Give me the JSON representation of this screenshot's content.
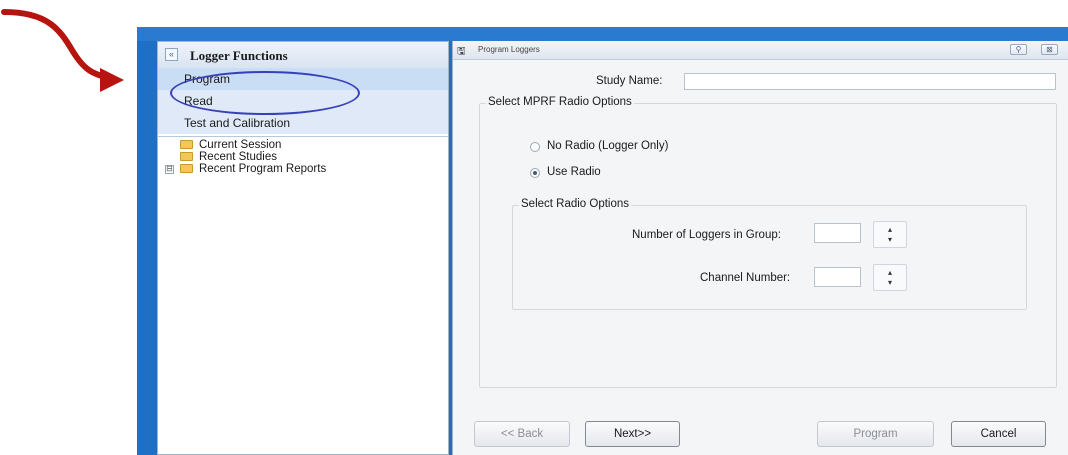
{
  "colors": {
    "window_accent": "#1f6fc4",
    "annotation_arrow": "#b8140f",
    "annotation_ellipse": "#3740b8",
    "nav_background": "#dfe9f7",
    "selected_nav": "#c9ddf5"
  },
  "left_panel": {
    "title": "Logger Functions",
    "nav_items": [
      {
        "label": "Program",
        "selected": true
      },
      {
        "label": "Read"
      },
      {
        "label": "Test and Calibration"
      }
    ],
    "tree": [
      {
        "label": "Current Session",
        "icon": "folder-icon"
      },
      {
        "label": "Recent Studies",
        "icon": "folder-icon"
      },
      {
        "label": "Recent Program Reports",
        "icon": "folder-icon",
        "expander": "⊟"
      }
    ]
  },
  "window": {
    "title": "Program Loggers",
    "pin_icon": "pin-icon",
    "close_icon": "close-icon",
    "pin_glyph": "⚲",
    "close_glyph": "⊠"
  },
  "form": {
    "study_name_label": "Study Name:",
    "study_name_value": "",
    "mprf_group_label": "Select MPRF Radio Options",
    "radio_no_radio": "No Radio (Logger Only)",
    "radio_use_radio": "Use Radio",
    "selected_radio": "Use Radio",
    "radio_group_label": "Select Radio Options",
    "loggers_label": "Number of Loggers in Group:",
    "loggers_value": "",
    "channel_label": "Channel Number:",
    "channel_value": ""
  },
  "buttons": {
    "back": "<< Back",
    "next": "Next>>",
    "program": "Program",
    "cancel": "Cancel"
  }
}
